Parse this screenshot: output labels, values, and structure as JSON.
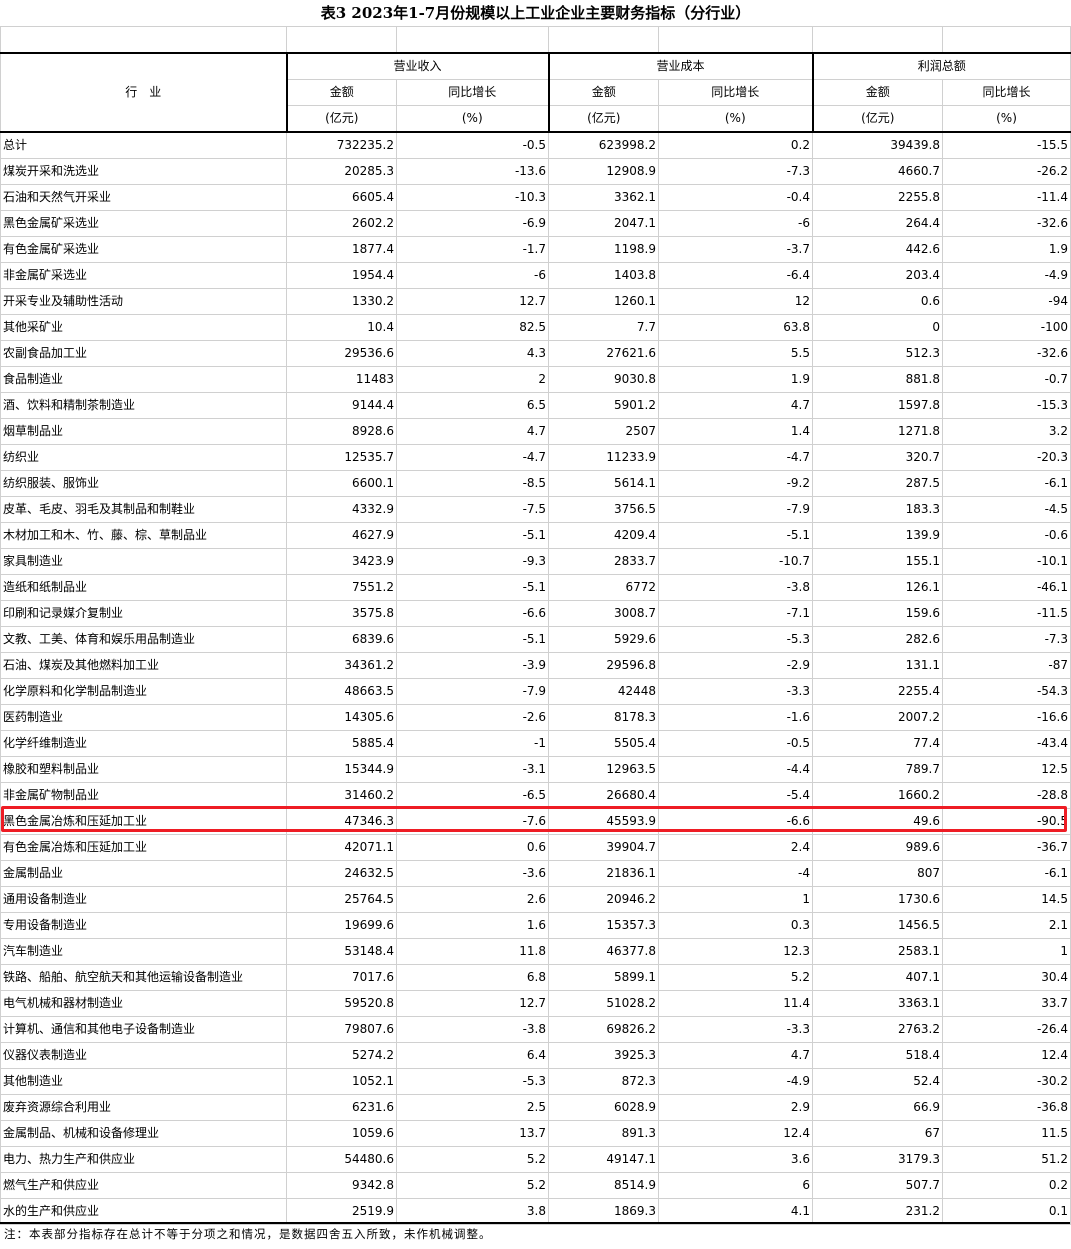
{
  "title": "表3   2023年1-7月份规模以上工业企业主要财务指标（分行业）",
  "headers": {
    "industry": "行　业",
    "groups": [
      "营业收入",
      "营业成本",
      "利润总额"
    ],
    "amount": "金额",
    "growth": "同比增长",
    "amount_unit": "(亿元)",
    "growth_unit": "(%)"
  },
  "rows": [
    {
      "name": "总计",
      "v": [
        "732235.2",
        "-0.5",
        "623998.2",
        "0.2",
        "39439.8",
        "-15.5"
      ]
    },
    {
      "name": "煤炭开采和洗选业",
      "v": [
        "20285.3",
        "-13.6",
        "12908.9",
        "-7.3",
        "4660.7",
        "-26.2"
      ]
    },
    {
      "name": "石油和天然气开采业",
      "v": [
        "6605.4",
        "-10.3",
        "3362.1",
        "-0.4",
        "2255.8",
        "-11.4"
      ]
    },
    {
      "name": "黑色金属矿采选业",
      "v": [
        "2602.2",
        "-6.9",
        "2047.1",
        "-6",
        "264.4",
        "-32.6"
      ]
    },
    {
      "name": "有色金属矿采选业",
      "v": [
        "1877.4",
        "-1.7",
        "1198.9",
        "-3.7",
        "442.6",
        "1.9"
      ]
    },
    {
      "name": "非金属矿采选业",
      "v": [
        "1954.4",
        "-6",
        "1403.8",
        "-6.4",
        "203.4",
        "-4.9"
      ]
    },
    {
      "name": "开采专业及辅助性活动",
      "v": [
        "1330.2",
        "12.7",
        "1260.1",
        "12",
        "0.6",
        "-94"
      ]
    },
    {
      "name": "其他采矿业",
      "v": [
        "10.4",
        "82.5",
        "7.7",
        "63.8",
        "0",
        "-100"
      ]
    },
    {
      "name": "农副食品加工业",
      "v": [
        "29536.6",
        "4.3",
        "27621.6",
        "5.5",
        "512.3",
        "-32.6"
      ]
    },
    {
      "name": "食品制造业",
      "v": [
        "11483",
        "2",
        "9030.8",
        "1.9",
        "881.8",
        "-0.7"
      ]
    },
    {
      "name": "酒、饮料和精制茶制造业",
      "v": [
        "9144.4",
        "6.5",
        "5901.2",
        "4.7",
        "1597.8",
        "-15.3"
      ]
    },
    {
      "name": "烟草制品业",
      "v": [
        "8928.6",
        "4.7",
        "2507",
        "1.4",
        "1271.8",
        "3.2"
      ]
    },
    {
      "name": "纺织业",
      "v": [
        "12535.7",
        "-4.7",
        "11233.9",
        "-4.7",
        "320.7",
        "-20.3"
      ]
    },
    {
      "name": "纺织服装、服饰业",
      "v": [
        "6600.1",
        "-8.5",
        "5614.1",
        "-9.2",
        "287.5",
        "-6.1"
      ]
    },
    {
      "name": "皮革、毛皮、羽毛及其制品和制鞋业",
      "v": [
        "4332.9",
        "-7.5",
        "3756.5",
        "-7.9",
        "183.3",
        "-4.5"
      ]
    },
    {
      "name": "木材加工和木、竹、藤、棕、草制品业",
      "v": [
        "4627.9",
        "-5.1",
        "4209.4",
        "-5.1",
        "139.9",
        "-0.6"
      ]
    },
    {
      "name": "家具制造业",
      "v": [
        "3423.9",
        "-9.3",
        "2833.7",
        "-10.7",
        "155.1",
        "-10.1"
      ]
    },
    {
      "name": "造纸和纸制品业",
      "v": [
        "7551.2",
        "-5.1",
        "6772",
        "-3.8",
        "126.1",
        "-46.1"
      ]
    },
    {
      "name": "印刷和记录媒介复制业",
      "v": [
        "3575.8",
        "-6.6",
        "3008.7",
        "-7.1",
        "159.6",
        "-11.5"
      ]
    },
    {
      "name": "文教、工美、体育和娱乐用品制造业",
      "v": [
        "6839.6",
        "-5.1",
        "5929.6",
        "-5.3",
        "282.6",
        "-7.3"
      ]
    },
    {
      "name": "石油、煤炭及其他燃料加工业",
      "v": [
        "34361.2",
        "-3.9",
        "29596.8",
        "-2.9",
        "131.1",
        "-87"
      ]
    },
    {
      "name": "化学原料和化学制品制造业",
      "v": [
        "48663.5",
        "-7.9",
        "42448",
        "-3.3",
        "2255.4",
        "-54.3"
      ]
    },
    {
      "name": "医药制造业",
      "v": [
        "14305.6",
        "-2.6",
        "8178.3",
        "-1.6",
        "2007.2",
        "-16.6"
      ]
    },
    {
      "name": "化学纤维制造业",
      "v": [
        "5885.4",
        "-1",
        "5505.4",
        "-0.5",
        "77.4",
        "-43.4"
      ]
    },
    {
      "name": "橡胶和塑料制品业",
      "v": [
        "15344.9",
        "-3.1",
        "12963.5",
        "-4.4",
        "789.7",
        "12.5"
      ]
    },
    {
      "name": "非金属矿物制品业",
      "v": [
        "31460.2",
        "-6.5",
        "26680.4",
        "-5.4",
        "1660.2",
        "-28.8"
      ]
    },
    {
      "name": "黑色金属冶炼和压延加工业",
      "v": [
        "47346.3",
        "-7.6",
        "45593.9",
        "-6.6",
        "49.6",
        "-90.5"
      ]
    },
    {
      "name": "有色金属冶炼和压延加工业",
      "v": [
        "42071.1",
        "0.6",
        "39904.7",
        "2.4",
        "989.6",
        "-36.7"
      ]
    },
    {
      "name": "金属制品业",
      "v": [
        "24632.5",
        "-3.6",
        "21836.1",
        "-4",
        "807",
        "-6.1"
      ]
    },
    {
      "name": "通用设备制造业",
      "v": [
        "25764.5",
        "2.6",
        "20946.2",
        "1",
        "1730.6",
        "14.5"
      ]
    },
    {
      "name": "专用设备制造业",
      "v": [
        "19699.6",
        "1.6",
        "15357.3",
        "0.3",
        "1456.5",
        "2.1"
      ]
    },
    {
      "name": "汽车制造业",
      "v": [
        "53148.4",
        "11.8",
        "46377.8",
        "12.3",
        "2583.1",
        "1"
      ]
    },
    {
      "name": "铁路、船舶、航空航天和其他运输设备制造业",
      "v": [
        "7017.6",
        "6.8",
        "5899.1",
        "5.2",
        "407.1",
        "30.4"
      ]
    },
    {
      "name": "电气机械和器材制造业",
      "v": [
        "59520.8",
        "12.7",
        "51028.2",
        "11.4",
        "3363.1",
        "33.7"
      ]
    },
    {
      "name": "计算机、通信和其他电子设备制造业",
      "v": [
        "79807.6",
        "-3.8",
        "69826.2",
        "-3.3",
        "2763.2",
        "-26.4"
      ]
    },
    {
      "name": "仪器仪表制造业",
      "v": [
        "5274.2",
        "6.4",
        "3925.3",
        "4.7",
        "518.4",
        "12.4"
      ]
    },
    {
      "name": "其他制造业",
      "v": [
        "1052.1",
        "-5.3",
        "872.3",
        "-4.9",
        "52.4",
        "-30.2"
      ]
    },
    {
      "name": "废弃资源综合利用业",
      "v": [
        "6231.6",
        "2.5",
        "6028.9",
        "2.9",
        "66.9",
        "-36.8"
      ]
    },
    {
      "name": "金属制品、机械和设备修理业",
      "v": [
        "1059.6",
        "13.7",
        "891.3",
        "12.4",
        "67",
        "11.5"
      ]
    },
    {
      "name": "电力、热力生产和供应业",
      "v": [
        "54480.6",
        "5.2",
        "49147.1",
        "3.6",
        "3179.3",
        "51.2"
      ]
    },
    {
      "name": "燃气生产和供应业",
      "v": [
        "9342.8",
        "5.2",
        "8514.9",
        "6",
        "507.7",
        "0.2"
      ]
    },
    {
      "name": "水的生产和供应业",
      "v": [
        "2519.9",
        "3.8",
        "1869.3",
        "4.1",
        "231.2",
        "0.1"
      ]
    }
  ],
  "highlight_color": "#ee1c24",
  "footnote": "注：本表部分指标存在总计不等于分项之和情况，是数据四舍五入所致，未作机械调整。"
}
